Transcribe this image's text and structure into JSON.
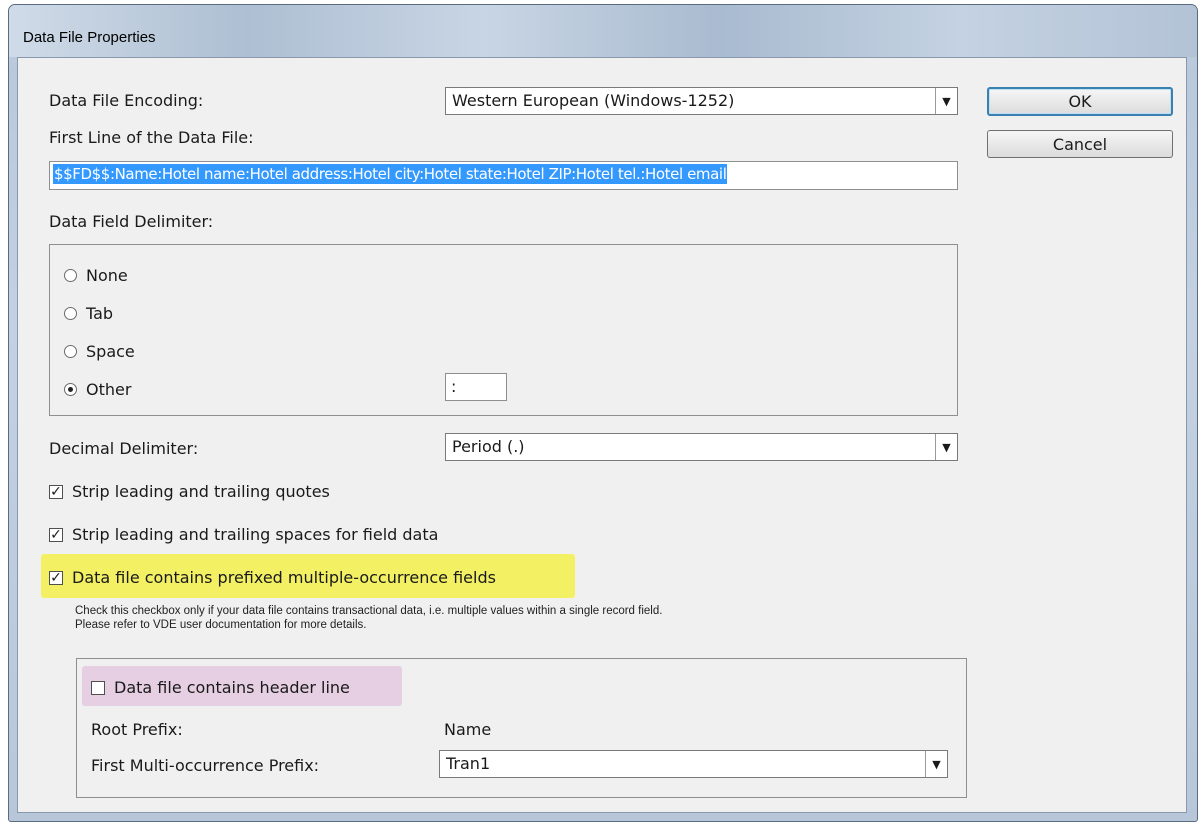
{
  "window": {
    "title": "Data File Properties"
  },
  "buttons": {
    "ok": "OK",
    "cancel": "Cancel"
  },
  "encoding": {
    "label": "Data File Encoding:",
    "value": "Western European (Windows-1252)"
  },
  "first_line": {
    "label": "First Line of the Data File:",
    "value": "$$FD$$:Name:Hotel name:Hotel address:Hotel city:Hotel state:Hotel ZIP:Hotel tel.:Hotel email"
  },
  "delimiter": {
    "label": "Data Field Delimiter:",
    "options": [
      "None",
      "Tab",
      "Space",
      "Other"
    ],
    "selected": "Other",
    "other_value": ":"
  },
  "decimal": {
    "label": "Decimal Delimiter:",
    "value": "Period (.)"
  },
  "checkboxes": {
    "strip_quotes": {
      "label": "Strip leading and trailing quotes",
      "checked": true
    },
    "strip_spaces": {
      "label": "Strip leading and trailing spaces for field data",
      "checked": true
    },
    "multi_occurrence": {
      "label": "Data file contains prefixed multiple-occurrence fields",
      "checked": true
    }
  },
  "hint": {
    "line1": "Check this checkbox only if your data file contains transactional data, i.e. multiple values within a single record field.",
    "line2": "Please refer to VDE user documentation for more details."
  },
  "multi_group": {
    "header_line": {
      "label": "Data file contains header line",
      "checked": false
    },
    "root_prefix_label": "Root Prefix:",
    "root_prefix_value": "Name",
    "first_prefix_label": "First Multi-occurrence Prefix:",
    "first_prefix_value": "Tran1"
  },
  "colors": {
    "highlight_yellow": "#f3f064",
    "highlight_pink": "#e6cfe3",
    "selection": "#3399ff"
  }
}
